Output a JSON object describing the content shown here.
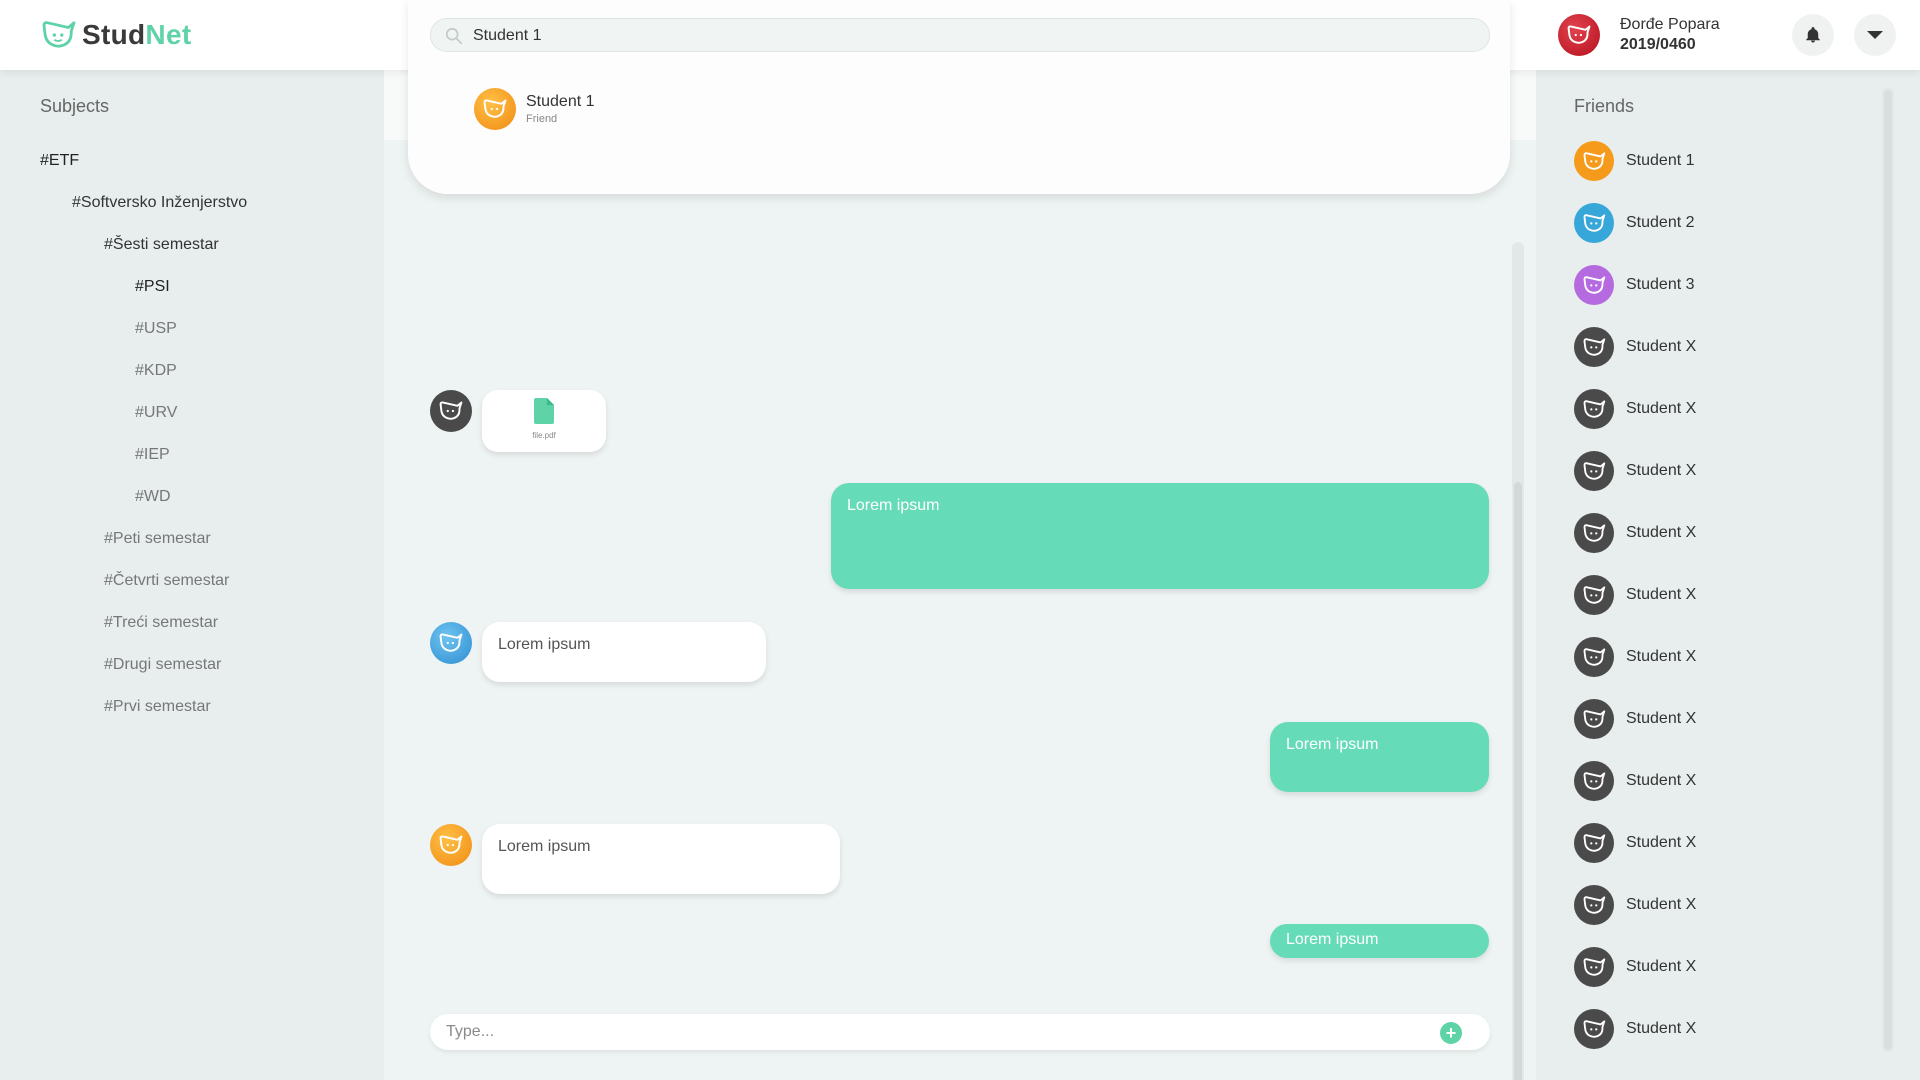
{
  "app": {
    "logo_prefix": "Stud",
    "logo_suffix": "Net",
    "brand_color": "#5fd3a8"
  },
  "header": {
    "user_name": "Đorđe Popara",
    "user_id": "2019/0460",
    "bell_icon": "bell-icon",
    "menu_icon": "chevron-down-icon"
  },
  "search": {
    "value": "Student 1",
    "results": [
      {
        "name": "Student 1",
        "relation": "Friend",
        "avatar_color": "#f59a1b"
      }
    ]
  },
  "subjects": {
    "title": "Subjects",
    "items": [
      {
        "label": "#ETF"
      },
      {
        "label": "#Softversko Inženjerstvo"
      },
      {
        "label": "#Šesti semestar"
      },
      {
        "label": "#PSI"
      },
      {
        "label": "#USP"
      },
      {
        "label": "#KDP"
      },
      {
        "label": "#URV"
      },
      {
        "label": "#IEP"
      },
      {
        "label": "#WD"
      },
      {
        "label": "#Peti semestar"
      },
      {
        "label": "#Četvrti semestar"
      },
      {
        "label": "#Treći semestar"
      },
      {
        "label": "#Drugi semestar"
      },
      {
        "label": "#Prvi semestar"
      }
    ]
  },
  "chat": {
    "file_name": "file.pdf",
    "messages": [
      {
        "direction": "out",
        "text": "Lorem ipsum"
      },
      {
        "direction": "in",
        "text": "Lorem ipsum",
        "avatar_color": "#2f8ed1"
      },
      {
        "direction": "out",
        "text": "Lorem ipsum"
      },
      {
        "direction": "in",
        "text": "Lorem ipsum",
        "avatar_color": "#f59a1b"
      },
      {
        "direction": "out",
        "text": "Lorem ipsum"
      }
    ],
    "input_placeholder": "Type...",
    "add_icon": "plus-icon",
    "outgoing_color": "#66dbb7"
  },
  "friends": {
    "title": "Friends",
    "items": [
      {
        "name": "Student 1",
        "avatar_color": "#f59a1b"
      },
      {
        "name": "Student 2",
        "avatar_color": "#36a7d8"
      },
      {
        "name": "Student 3",
        "avatar_color": "#b56ae0"
      },
      {
        "name": "Student X",
        "avatar_color": "#4a4a4a"
      },
      {
        "name": "Student X",
        "avatar_color": "#4a4a4a"
      },
      {
        "name": "Student X",
        "avatar_color": "#4a4a4a"
      },
      {
        "name": "Student X",
        "avatar_color": "#4a4a4a"
      },
      {
        "name": "Student X",
        "avatar_color": "#4a4a4a"
      },
      {
        "name": "Student X",
        "avatar_color": "#4a4a4a"
      },
      {
        "name": "Student X",
        "avatar_color": "#4a4a4a"
      },
      {
        "name": "Student X",
        "avatar_color": "#4a4a4a"
      },
      {
        "name": "Student X",
        "avatar_color": "#4a4a4a"
      },
      {
        "name": "Student X",
        "avatar_color": "#4a4a4a"
      },
      {
        "name": "Student X",
        "avatar_color": "#4a4a4a"
      },
      {
        "name": "Student X",
        "avatar_color": "#4a4a4a"
      }
    ]
  }
}
